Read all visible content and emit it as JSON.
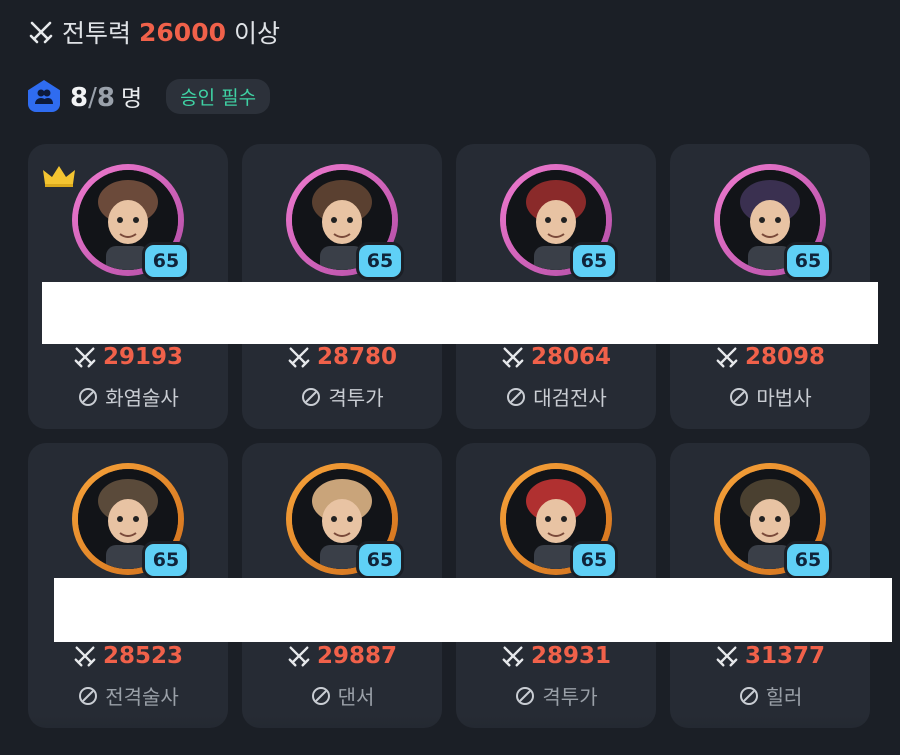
{
  "requirement": {
    "label": "전투력",
    "value": "26000",
    "suffix": "이상"
  },
  "party": {
    "current": "8",
    "slash": "/",
    "max": "8",
    "unit": "명",
    "badge": "승인 필수"
  },
  "members": [
    {
      "level": "65",
      "power": "29193",
      "class": "화염술사",
      "leader": true,
      "ring": "pink"
    },
    {
      "level": "65",
      "power": "28780",
      "class": "격투가",
      "leader": false,
      "ring": "pink"
    },
    {
      "level": "65",
      "power": "28064",
      "class": "대검전사",
      "leader": false,
      "ring": "pink"
    },
    {
      "level": "65",
      "power": "28098",
      "class": "마법사",
      "leader": false,
      "ring": "pink"
    },
    {
      "level": "65",
      "power": "28523",
      "class": "전격술사",
      "leader": false,
      "ring": "orange"
    },
    {
      "level": "65",
      "power": "29887",
      "class": "댄서",
      "leader": false,
      "ring": "orange"
    },
    {
      "level": "65",
      "power": "28931",
      "class": "격투가",
      "leader": false,
      "ring": "orange"
    },
    {
      "level": "65",
      "power": "31377",
      "class": "힐러",
      "leader": false,
      "ring": "orange"
    }
  ],
  "colors": {
    "power": "#f0614a",
    "badge": "#3fd2a4",
    "level_badge": "#5fd0f6",
    "ring_pink": "#e06ac4",
    "ring_orange": "#e98a2a"
  }
}
